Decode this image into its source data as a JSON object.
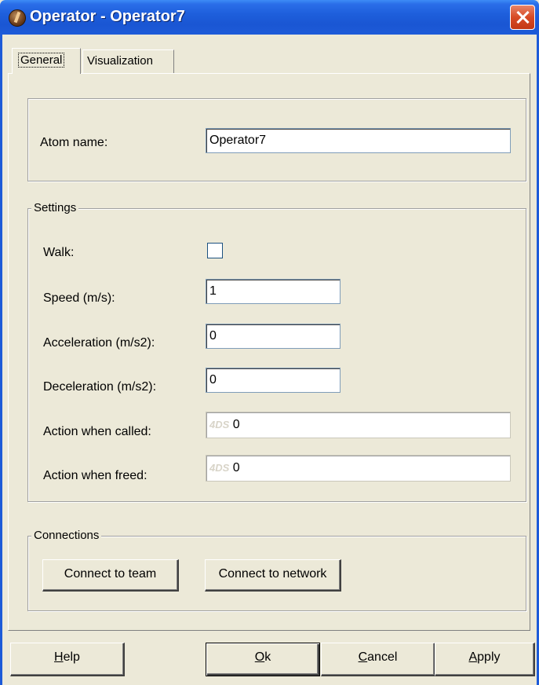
{
  "window": {
    "title": "Operator - Operator7"
  },
  "tabs": [
    {
      "label": "General",
      "selected": true
    },
    {
      "label": "Visualization",
      "selected": false
    }
  ],
  "general": {
    "atom_name_label": "Atom name:",
    "atom_name_value": "Operator7"
  },
  "settings": {
    "legend": "Settings",
    "walk_label": "Walk:",
    "walk_checked": false,
    "speed_label": "Speed (m/s):",
    "speed_value": "1",
    "acceleration_label": "Acceleration (m/s2):",
    "acceleration_value": "0",
    "deceleration_label": "Deceleration (m/s2):",
    "deceleration_value": "0",
    "action_called_label": "Action when called:",
    "action_called_prefix": "4DS",
    "action_called_value": "0",
    "action_freed_label": "Action when freed:",
    "action_freed_prefix": "4DS",
    "action_freed_value": "0"
  },
  "connections": {
    "legend": "Connections",
    "connect_team_label": "Connect to team",
    "connect_network_label": "Connect to network"
  },
  "footer": {
    "help_label": "Help",
    "help_mnemonic": "H",
    "ok_label": "Ok",
    "ok_mnemonic": "O",
    "cancel_label": "Cancel",
    "cancel_mnemonic": "C",
    "apply_label": "Apply",
    "apply_mnemonic": "A"
  }
}
